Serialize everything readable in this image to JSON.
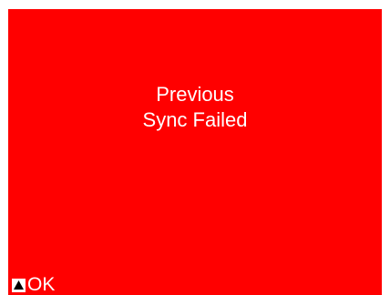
{
  "dialog": {
    "line1": "Previous",
    "line2": "Sync Failed"
  },
  "softkey": {
    "icon": "up-triangle-icon",
    "label": "OK"
  },
  "colors": {
    "background": "#ff0000",
    "text": "#ffffff"
  }
}
